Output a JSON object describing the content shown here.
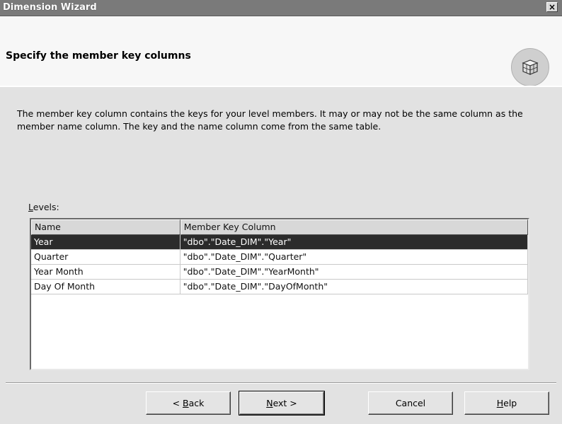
{
  "window": {
    "title": "Dimension Wizard",
    "close_glyph": "×"
  },
  "header": {
    "heading": "Specify the member key columns",
    "icon": "cube-icon"
  },
  "description": "The member key column contains the keys for your level members.  It may or may not be the same column as the member name column.  The key and the name column come from the same table.",
  "levels": {
    "label_mnemonic": "L",
    "label_rest": "evels:",
    "columns": [
      "Name",
      "Member Key Column"
    ],
    "rows": [
      {
        "name": "Year",
        "key": "\"dbo\".\"Date_DIM\".\"Year\"",
        "selected": true
      },
      {
        "name": "Quarter",
        "key": "\"dbo\".\"Date_DIM\".\"Quarter\"",
        "selected": false
      },
      {
        "name": "Year Month",
        "key": "\"dbo\".\"Date_DIM\".\"YearMonth\"",
        "selected": false
      },
      {
        "name": "Day Of Month",
        "key": "\"dbo\".\"Date_DIM\".\"DayOfMonth\"",
        "selected": false
      }
    ]
  },
  "buttons": {
    "back": {
      "pre": "< ",
      "mnemonic": "B",
      "post": "ack"
    },
    "next": {
      "pre": "",
      "mnemonic": "N",
      "post": "ext >"
    },
    "cancel": {
      "label": "Cancel"
    },
    "help": {
      "pre": "",
      "mnemonic": "H",
      "post": "elp"
    }
  }
}
